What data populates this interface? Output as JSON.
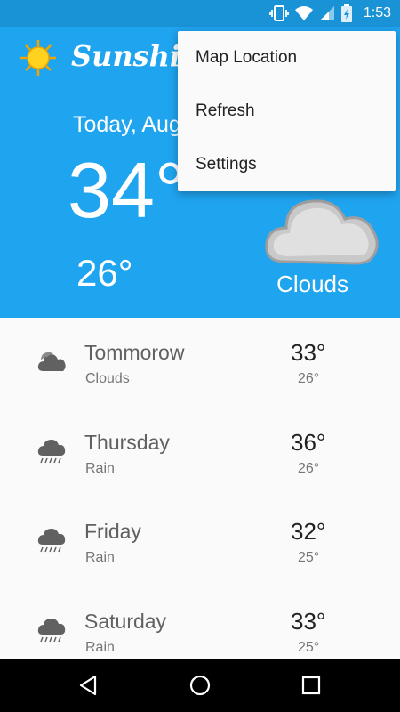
{
  "status_bar": {
    "time": "1:53",
    "icons": [
      "vibrate-icon",
      "wifi-icon",
      "signal-icon",
      "battery-charging-icon"
    ]
  },
  "app": {
    "title": "Sunshine"
  },
  "today": {
    "date": "Today, Aug",
    "high": "34°",
    "low": "26°",
    "description": "Clouds",
    "icon": "cloud-icon"
  },
  "menu": {
    "items": [
      {
        "label": "Map Location"
      },
      {
        "label": "Refresh"
      },
      {
        "label": "Settings"
      }
    ]
  },
  "forecast": [
    {
      "day": "Tommorow",
      "description": "Clouds",
      "high": "33°",
      "low": "26°",
      "icon": "cloud-icon"
    },
    {
      "day": "Thursday",
      "description": "Rain",
      "high": "36°",
      "low": "26°",
      "icon": "rain-icon"
    },
    {
      "day": "Friday",
      "description": "Rain",
      "high": "32°",
      "low": "25°",
      "icon": "rain-icon"
    },
    {
      "day": "Saturday",
      "description": "Rain",
      "high": "33°",
      "low": "25°",
      "icon": "rain-icon"
    }
  ],
  "colors": {
    "header": "#1fa4ef",
    "status_bar": "#1a92d6",
    "list_background": "#fafafa"
  }
}
